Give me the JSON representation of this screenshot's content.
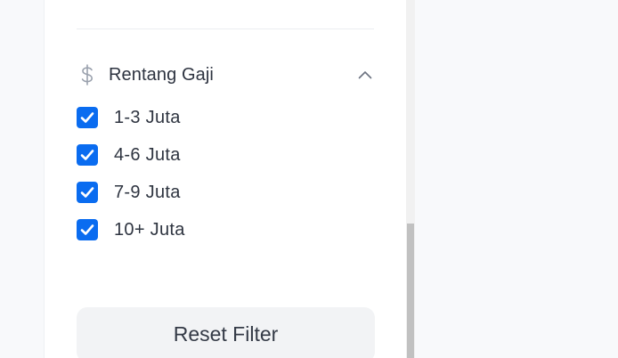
{
  "filter_panel": {
    "salary_section": {
      "title": "Rentang Gaji",
      "icon": "dollar-icon",
      "expanded": true,
      "options": [
        {
          "label": "1-3 Juta",
          "checked": true
        },
        {
          "label": "4-6 Juta",
          "checked": true
        },
        {
          "label": "7-9 Juta",
          "checked": true
        },
        {
          "label": "10+ Juta",
          "checked": true
        }
      ]
    },
    "reset_label": "Reset Filter"
  },
  "colors": {
    "checkbox": "#0a6cf0",
    "title_text": "#2d3340",
    "button_bg": "#f2f3f5"
  }
}
